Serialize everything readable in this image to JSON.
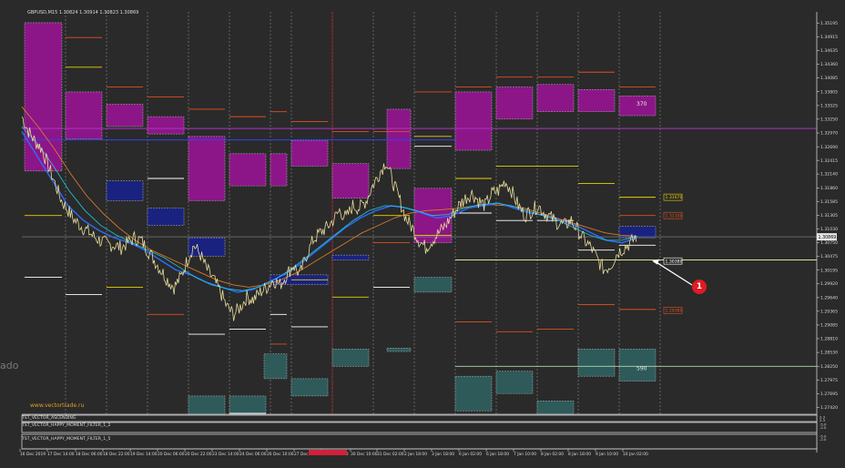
{
  "chart_data": {
    "type": "line",
    "symbol_line": "GBPUSD,M15  1.30824 1.30914 1.30823 1.30869",
    "watermark": "www.vectortrade.ru",
    "ylim": [
      1.2728,
      1.3542
    ],
    "y_ticks": [
      "1.35195",
      "1.34915",
      "1.34635",
      "1.34360",
      "1.34085",
      "1.33805",
      "1.33525",
      "1.33250",
      "1.32970",
      "1.32690",
      "1.32415",
      "1.32140",
      "1.31860",
      "1.31585",
      "1.31305",
      "1.31030",
      "1.30750",
      "1.30475",
      "1.30195",
      "1.29920",
      "1.29640",
      "1.29365",
      "1.29085",
      "1.28810",
      "1.28530",
      "1.28250",
      "1.27975",
      "1.27695",
      "1.27420"
    ],
    "x_ticks": [
      "16 Dec 2019",
      "17 Dec 14:00",
      "18 Dec 06:00",
      "18 Dec 22:00",
      "19 Dec 14:00",
      "20 Dec 06:00",
      "20 Dec 22:00",
      "23 Dec 14:00",
      "24 Dec 06:00",
      "26 Dec 10:00",
      "27 Dec 02:00",
      "27 Dec 18:00",
      "30 Dec 10:00",
      "31 Dec 02:00",
      "2 Jan 18:00",
      "3 Jan 18:00",
      "6 Jan 02:00",
      "6 Jan 18:00",
      "7 Jan 10:00",
      "8 Jan 02:00",
      "8 Jan 18:00",
      "9 Jan 10:00",
      "10 Jan 02:00"
    ],
    "current_price": "1.30869",
    "price_labels": [
      {
        "text": "1.31670",
        "value": 1.3167,
        "color": "#e6d200"
      },
      {
        "text": "1.31300",
        "value": 1.313,
        "color": "#e05020"
      },
      {
        "text": "1.30380",
        "value": 1.3038,
        "color": "#ffffff"
      },
      {
        "text": "1.29380",
        "value": 1.2938,
        "color": "#e05020"
      }
    ],
    "zone_labels": [
      {
        "text": "370",
        "value": 1.3356
      },
      {
        "text": "590",
        "value": 1.2821
      }
    ],
    "callout": "1",
    "side_text": "ado",
    "indicators": [
      {
        "name": "TST_VECTOR_ASCENDING",
        "values": [
          "2.3",
          "2.3"
        ]
      },
      {
        "name": "TST_VECTOR_HAPPY_MOMENT_FILTER_1_2",
        "values": [
          "-5.0",
          "-2.0"
        ]
      },
      {
        "name": "TST_VECTOR_HAPPY_MOMENT_FILTER_1_5",
        "values": [
          "-5.0",
          "-2.0"
        ]
      }
    ],
    "colors": {
      "price": "#e8dc9a",
      "ma_blue": "#2d6cff",
      "ma_cyan": "#20c8d8",
      "ma_orange": "#d87828",
      "zone_purple": "#8c1688",
      "zone_navy": "#1a2280",
      "zone_teal": "#2e5a5a"
    },
    "series": [
      {
        "values": [
          1.333,
          1.33,
          1.328,
          1.3265,
          1.323,
          1.3195,
          1.316,
          1.314,
          1.312,
          1.3108,
          1.3098,
          1.3086,
          1.3078,
          1.3072,
          1.307,
          1.3065,
          1.3075,
          1.3085,
          1.308,
          1.306,
          1.304,
          1.302,
          1.3,
          1.2985,
          1.3005,
          1.304,
          1.307,
          1.305,
          1.302,
          1.3,
          1.2975,
          1.2945,
          1.293,
          1.2945,
          1.2965,
          1.296,
          1.2975,
          1.2985,
          1.3,
          1.299,
          1.301,
          1.303,
          1.301,
          1.305,
          1.308,
          1.3095,
          1.3105,
          1.312,
          1.314,
          1.3125,
          1.315,
          1.3145,
          1.316,
          1.319,
          1.3215,
          1.324,
          1.32,
          1.3165,
          1.3125,
          1.3105,
          1.308,
          1.3065,
          1.308,
          1.3095,
          1.311,
          1.313,
          1.315,
          1.3165,
          1.3175,
          1.316,
          1.315,
          1.3175,
          1.318,
          1.32,
          1.318,
          1.315,
          1.313,
          1.314,
          1.315,
          1.3135,
          1.3125,
          1.3115,
          1.311,
          1.312,
          1.31,
          1.308,
          1.3065,
          1.304,
          1.302,
          1.303,
          1.3055,
          1.3065,
          1.3075,
          1.309
        ]
      },
      {
        "values": [
          1.33,
          1.325,
          1.32,
          1.315,
          1.312,
          1.31,
          1.3085,
          1.3075,
          1.306,
          1.304,
          1.302,
          1.301,
          1.2995,
          1.2985,
          1.2975,
          1.298,
          1.2995,
          1.301,
          1.303,
          1.3055,
          1.308,
          1.3105,
          1.3125,
          1.314,
          1.315,
          1.3145,
          1.3135,
          1.3125,
          1.313,
          1.3145,
          1.315,
          1.3155,
          1.3145,
          1.3135,
          1.313,
          1.312,
          1.311,
          1.3095,
          1.308,
          1.3075,
          1.3085
        ]
      },
      {
        "values": [
          1.331,
          1.3275,
          1.323,
          1.318,
          1.314,
          1.311,
          1.309,
          1.3075,
          1.306,
          1.3045,
          1.3025,
          1.3005,
          1.299,
          1.2982,
          1.2978,
          1.2985,
          1.3,
          1.302,
          1.3045,
          1.307,
          1.3095,
          1.312,
          1.314,
          1.315,
          1.3148,
          1.314,
          1.313,
          1.3132,
          1.3145,
          1.3152,
          1.3155,
          1.315,
          1.314,
          1.313,
          1.312,
          1.3105,
          1.309,
          1.308,
          1.308,
          1.3088
        ]
      },
      {
        "values": [
          1.335,
          1.331,
          1.3265,
          1.3215,
          1.317,
          1.3135,
          1.3105,
          1.308,
          1.306,
          1.3045,
          1.303,
          1.3015,
          1.3,
          1.299,
          1.2985,
          1.299,
          1.3,
          1.3015,
          1.3035,
          1.3055,
          1.3075,
          1.3095,
          1.311,
          1.3125,
          1.3135,
          1.314,
          1.3142,
          1.3145,
          1.315,
          1.3152,
          1.315,
          1.3145,
          1.3135,
          1.3125,
          1.3115,
          1.3105,
          1.3095,
          1.309,
          1.3088
        ]
      }
    ]
  }
}
